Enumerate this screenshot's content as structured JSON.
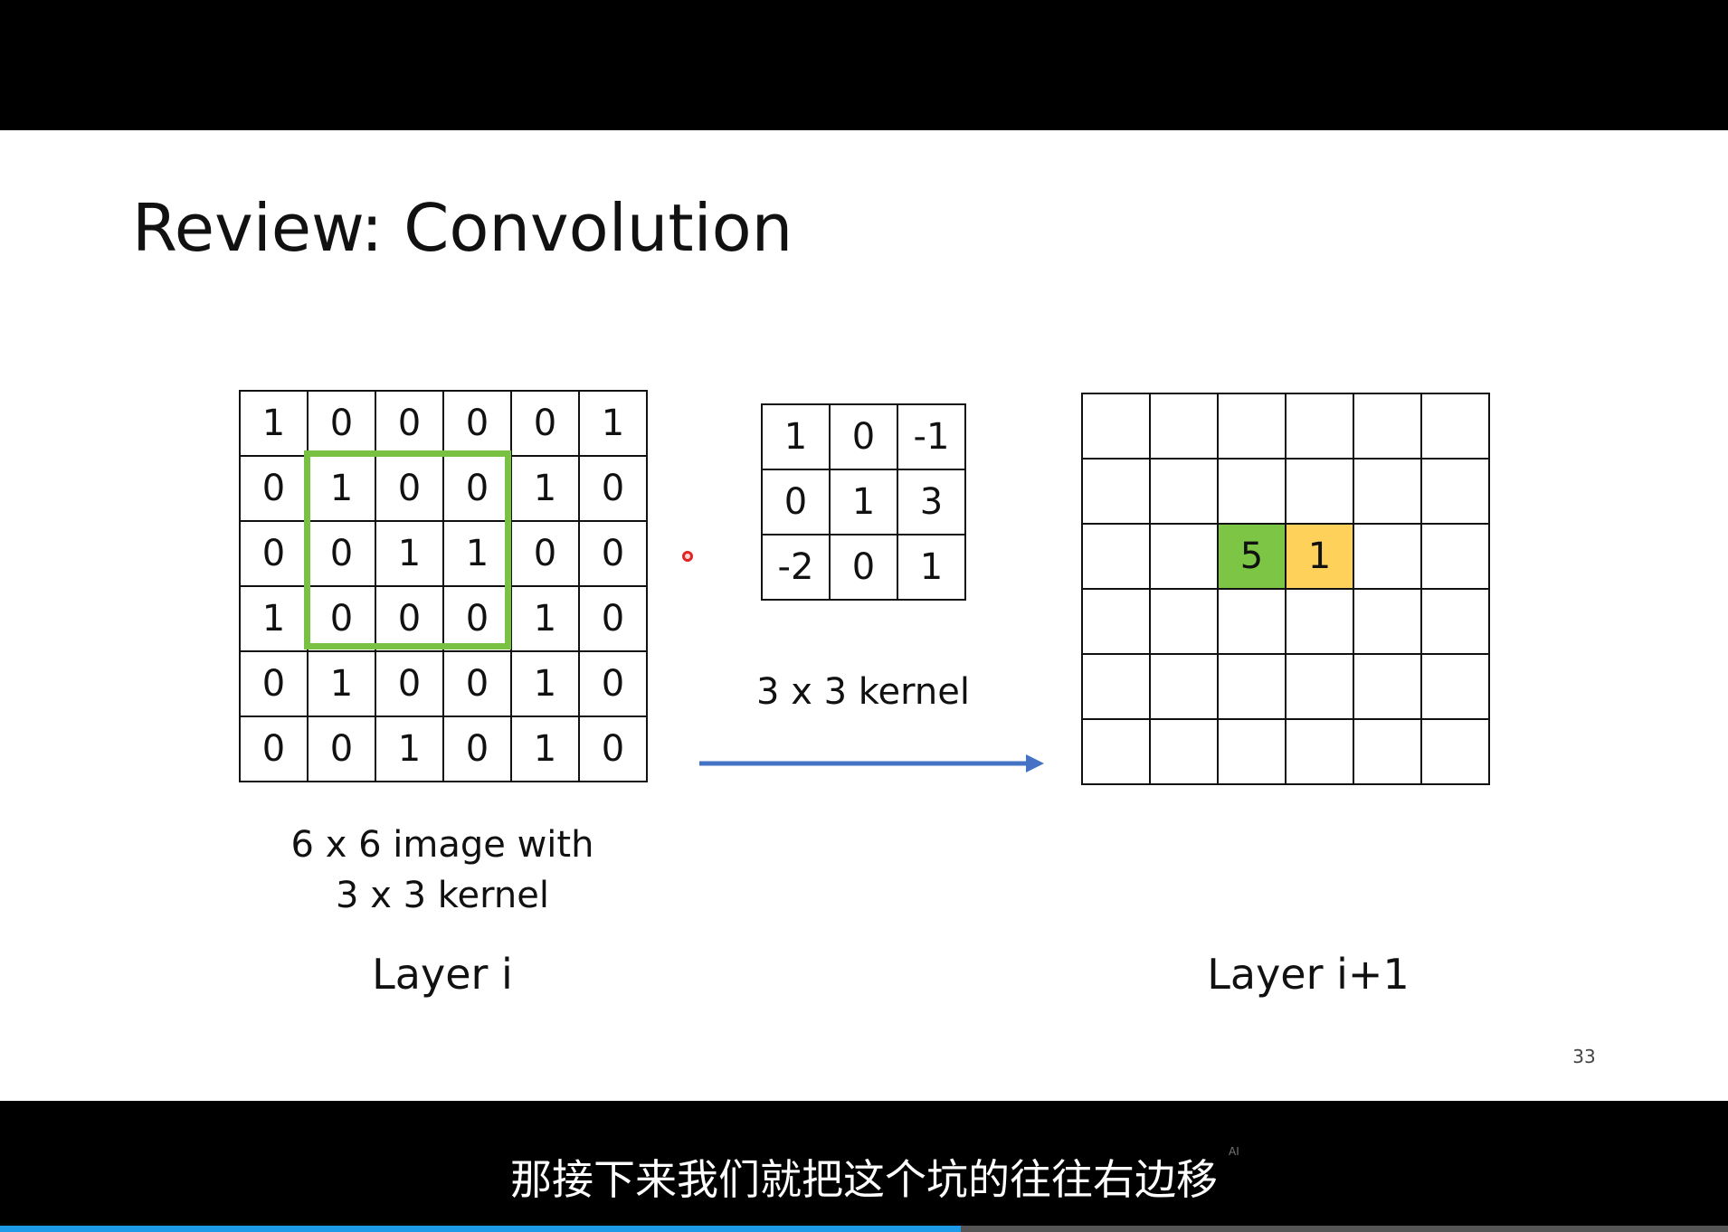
{
  "slide": {
    "title": "Review: Convolution",
    "image_grid": [
      [
        "1",
        "0",
        "0",
        "0",
        "0",
        "1"
      ],
      [
        "0",
        "1",
        "0",
        "0",
        "1",
        "0"
      ],
      [
        "0",
        "0",
        "1",
        "1",
        "0",
        "0"
      ],
      [
        "1",
        "0",
        "0",
        "0",
        "1",
        "0"
      ],
      [
        "0",
        "1",
        "0",
        "0",
        "1",
        "0"
      ],
      [
        "0",
        "0",
        "1",
        "0",
        "1",
        "0"
      ]
    ],
    "kernel_grid": [
      [
        "1",
        "0",
        "-1"
      ],
      [
        "0",
        "1",
        "3"
      ],
      [
        "-2",
        "0",
        "1"
      ]
    ],
    "output_grid": [
      [
        "",
        "",
        "",
        "",
        "",
        ""
      ],
      [
        "",
        "",
        "",
        "",
        "",
        ""
      ],
      [
        "",
        "",
        "5",
        "1",
        "",
        ""
      ],
      [
        "",
        "",
        "",
        "",
        "",
        ""
      ],
      [
        "",
        "",
        "",
        "",
        "",
        ""
      ],
      [
        "",
        "",
        "",
        "",
        "",
        ""
      ]
    ],
    "image_caption_line1": "6 x 6 image with",
    "image_caption_line2": "3 x 3 kernel",
    "kernel_caption": "3 x 3 kernel",
    "layer_left": "Layer i",
    "layer_right": "Layer i+1",
    "page_number": "33",
    "colors": {
      "one_digit": "#1a1adb",
      "window_green": "#78c143",
      "cell_green": "#7cc545",
      "cell_yellow": "#fdd15a",
      "arrow_blue": "#4472c4"
    }
  },
  "subtitle": {
    "text": "那接下来我们就把这个坑的往往右边移",
    "ai_mark": "AI"
  },
  "player": {
    "progress": 0.556
  }
}
